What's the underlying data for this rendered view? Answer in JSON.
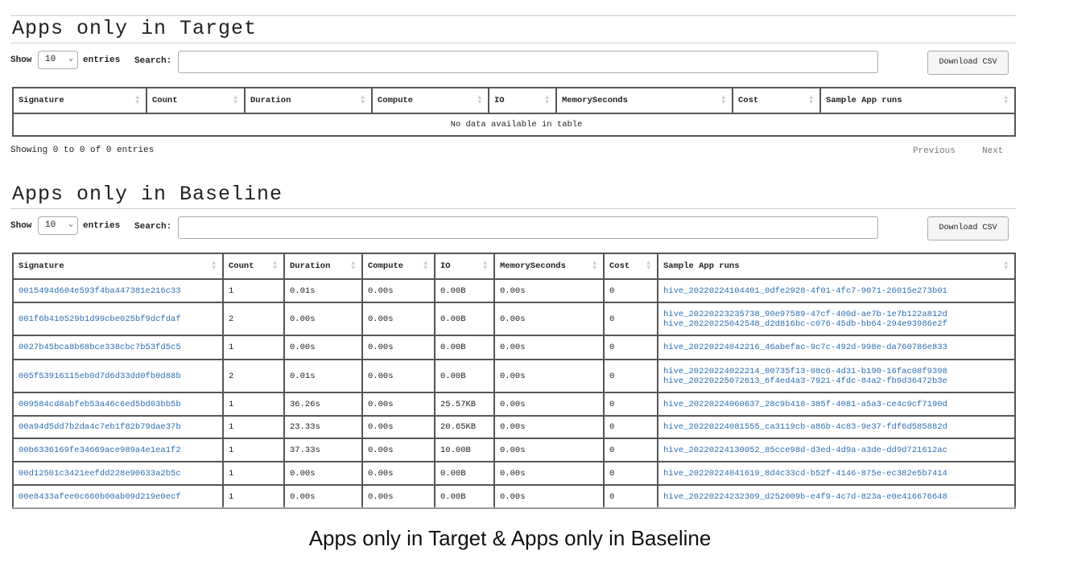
{
  "target": {
    "title": "Apps only in Target",
    "show_label": "Show",
    "entries_label": "entries",
    "page_length": "10",
    "search_label": "Search:",
    "search_value": "",
    "download_label": "Download CSV",
    "columns": [
      "Signature",
      "Count",
      "Duration",
      "Compute",
      "IO",
      "MemorySeconds",
      "Cost",
      "Sample App runs"
    ],
    "empty_message": "No data available in table",
    "info": "Showing 0 to 0 of 0 entries",
    "previous": "Previous",
    "next": "Next"
  },
  "baseline": {
    "title": "Apps only in Baseline",
    "show_label": "Show",
    "entries_label": "entries",
    "page_length": "10",
    "search_label": "Search:",
    "search_value": "",
    "download_label": "Download CSV",
    "columns": [
      "Signature",
      "Count",
      "Duration",
      "Compute",
      "IO",
      "MemorySeconds",
      "Cost",
      "Sample App runs"
    ],
    "rows": [
      {
        "signature": "0015494d604e593f4ba447381e216c33",
        "count": "1",
        "duration": "0.01s",
        "compute": "0.00s",
        "io": "0.00B",
        "memory": "0.00s",
        "cost": "0",
        "runs": [
          "hive_20220224104401_0dfe2928-4f01-4fc7-9071-26015e273b01"
        ]
      },
      {
        "signature": "001f6b410529b1d99cbe025bf9dcfdaf",
        "count": "2",
        "duration": "0.00s",
        "compute": "0.00s",
        "io": "0.00B",
        "memory": "0.00s",
        "cost": "0",
        "runs": [
          "hive_20220223235738_90e97589-47cf-400d-ae7b-1e7b122a812d",
          "hive_20220225042548_d2d816bc-c076-45db-bb64-294e93986e2f"
        ]
      },
      {
        "signature": "0027b45bca8b68bce338cbc7b53fd5c5",
        "count": "1",
        "duration": "0.00s",
        "compute": "0.00s",
        "io": "0.00B",
        "memory": "0.00s",
        "cost": "0",
        "runs": [
          "hive_20220224042216_46abefac-9c7c-492d-998e-da760786e833"
        ]
      },
      {
        "signature": "005f53916115eb0d7d6d33dd0fb0d88b",
        "count": "2",
        "duration": "0.01s",
        "compute": "0.00s",
        "io": "0.00B",
        "memory": "0.00s",
        "cost": "0",
        "runs": [
          "hive_20220224022214_00735f13-08c6-4d31-b190-16fac08f9398",
          "hive_20220225072613_6f4ed4a3-7921-4fdc-84a2-fb9d36472b3e"
        ]
      },
      {
        "signature": "009584cd8abfeb53a46c6ed5bd03bb5b",
        "count": "1",
        "duration": "36.26s",
        "compute": "0.00s",
        "io": "25.57KB",
        "memory": "0.00s",
        "cost": "0",
        "runs": [
          "hive_20220224060637_28c9b418-385f-4081-a5a3-ce4c9cf7190d"
        ]
      },
      {
        "signature": "00a94d5dd7b2da4c7eb1f82b79dae37b",
        "count": "1",
        "duration": "23.33s",
        "compute": "0.00s",
        "io": "20.65KB",
        "memory": "0.00s",
        "cost": "0",
        "runs": [
          "hive_20220224081555_ca3119cb-a86b-4c83-9e37-fdf6d585882d"
        ]
      },
      {
        "signature": "00b6336169fe34669ace989a4e1ea1f2",
        "count": "1",
        "duration": "37.33s",
        "compute": "0.00s",
        "io": "10.00B",
        "memory": "0.00s",
        "cost": "0",
        "runs": [
          "hive_20220224130052_85cce98d-d3ed-4d9a-a3de-dd9d721612ac"
        ]
      },
      {
        "signature": "00d12501c3421eefdd228e90633a2b5c",
        "count": "1",
        "duration": "0.00s",
        "compute": "0.00s",
        "io": "0.00B",
        "memory": "0.00s",
        "cost": "0",
        "runs": [
          "hive_20220224041619_8d4c33cd-b52f-4146-875e-ec382e5b7414"
        ]
      },
      {
        "signature": "00e8433afee0c660b00ab09d219e0ecf",
        "count": "1",
        "duration": "0.00s",
        "compute": "0.00s",
        "io": "0.00B",
        "memory": "0.00s",
        "cost": "0",
        "runs": [
          "hive_20220224232309_d252009b-e4f9-4c7d-823a-e0e416676648"
        ]
      }
    ]
  },
  "caption": "Apps only in Target & Apps only in Baseline",
  "colors": {
    "link": "#2a6fb0",
    "border": "#555555"
  }
}
